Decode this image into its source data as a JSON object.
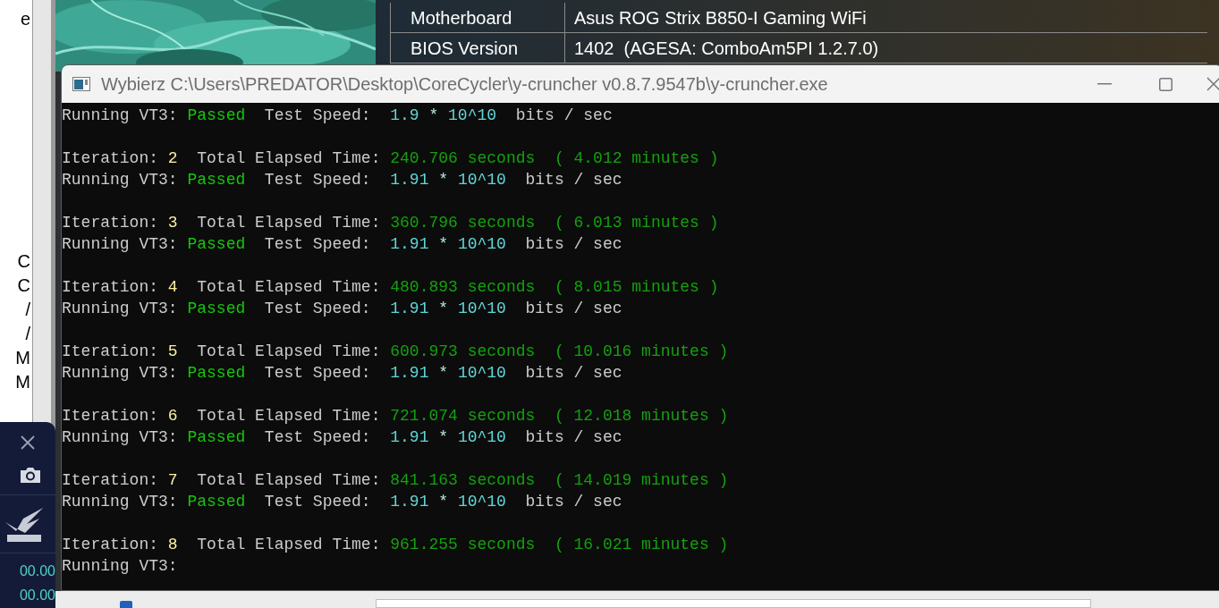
{
  "left_panel": {
    "letters": [
      "e",
      "C",
      "C",
      "/",
      "/",
      "M",
      "M"
    ]
  },
  "spec_table": {
    "rows": [
      {
        "label": "Motherboard",
        "value": "Asus ROG Strix B850-I Gaming WiFi"
      },
      {
        "label": "BIOS Version",
        "value": "1402  (AGESA: ComboAm5PI 1.2.7.0)"
      }
    ]
  },
  "console": {
    "title": "Wybierz C:\\Users\\PREDATOR\\Desktop\\CoreCycler\\y-cruncher v0.8.7.9547b\\y-cruncher.exe",
    "lines": [
      {
        "kind": "speed",
        "label": "Running VT3:",
        "result": "Passed",
        "speed_label": "Test Speed:",
        "value": "1.9",
        "operator": "*",
        "power": "10^10",
        "unit": "bits / sec"
      },
      {
        "kind": "blank"
      },
      {
        "kind": "iteration",
        "label": "Iteration:",
        "number": "2",
        "elapsed_label": "Total Elapsed Time:",
        "seconds": "240.706 seconds",
        "minutes": "( 4.012 minutes )"
      },
      {
        "kind": "speed",
        "label": "Running VT3:",
        "result": "Passed",
        "speed_label": "Test Speed:",
        "value": "1.91",
        "operator": "*",
        "power": "10^10",
        "unit": "bits / sec"
      },
      {
        "kind": "blank"
      },
      {
        "kind": "iteration",
        "label": "Iteration:",
        "number": "3",
        "elapsed_label": "Total Elapsed Time:",
        "seconds": "360.796 seconds",
        "minutes": "( 6.013 minutes )"
      },
      {
        "kind": "speed",
        "label": "Running VT3:",
        "result": "Passed",
        "speed_label": "Test Speed:",
        "value": "1.91",
        "operator": "*",
        "power": "10^10",
        "unit": "bits / sec"
      },
      {
        "kind": "blank"
      },
      {
        "kind": "iteration",
        "label": "Iteration:",
        "number": "4",
        "elapsed_label": "Total Elapsed Time:",
        "seconds": "480.893 seconds",
        "minutes": "( 8.015 minutes )"
      },
      {
        "kind": "speed",
        "label": "Running VT3:",
        "result": "Passed",
        "speed_label": "Test Speed:",
        "value": "1.91",
        "operator": "*",
        "power": "10^10",
        "unit": "bits / sec"
      },
      {
        "kind": "blank"
      },
      {
        "kind": "iteration",
        "label": "Iteration:",
        "number": "5",
        "elapsed_label": "Total Elapsed Time:",
        "seconds": "600.973 seconds",
        "minutes": "( 10.016 minutes )"
      },
      {
        "kind": "speed",
        "label": "Running VT3:",
        "result": "Passed",
        "speed_label": "Test Speed:",
        "value": "1.91",
        "operator": "*",
        "power": "10^10",
        "unit": "bits / sec"
      },
      {
        "kind": "blank"
      },
      {
        "kind": "iteration",
        "label": "Iteration:",
        "number": "6",
        "elapsed_label": "Total Elapsed Time:",
        "seconds": "721.074 seconds",
        "minutes": "( 12.018 minutes )"
      },
      {
        "kind": "speed",
        "label": "Running VT3:",
        "result": "Passed",
        "speed_label": "Test Speed:",
        "value": "1.91",
        "operator": "*",
        "power": "10^10",
        "unit": "bits / sec"
      },
      {
        "kind": "blank"
      },
      {
        "kind": "iteration",
        "label": "Iteration:",
        "number": "7",
        "elapsed_label": "Total Elapsed Time:",
        "seconds": "841.163 seconds",
        "minutes": "( 14.019 minutes )"
      },
      {
        "kind": "speed",
        "label": "Running VT3:",
        "result": "Passed",
        "speed_label": "Test Speed:",
        "value": "1.91",
        "operator": "*",
        "power": "10^10",
        "unit": "bits / sec"
      },
      {
        "kind": "blank"
      },
      {
        "kind": "iteration",
        "label": "Iteration:",
        "number": "8",
        "elapsed_label": "Total Elapsed Time:",
        "seconds": "961.255 seconds",
        "minutes": "( 16.021 minutes )"
      },
      {
        "kind": "pending",
        "label": "Running VT3:"
      }
    ]
  },
  "overlay": {
    "readings": [
      "00.00",
      "00.00"
    ]
  }
}
